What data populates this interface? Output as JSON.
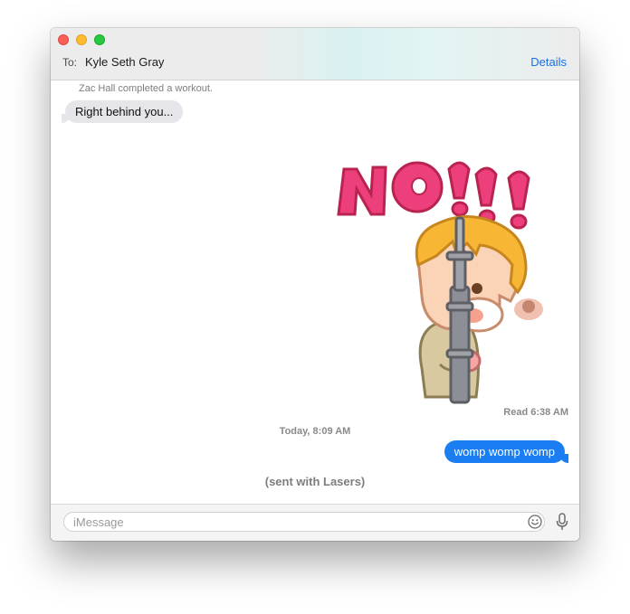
{
  "header": {
    "to_label": "To:",
    "recipient": "Kyle Seth Gray",
    "details_label": "Details"
  },
  "transcript": {
    "system_note": "Zac Hall completed a workout.",
    "incoming_message": "Right behind you...",
    "sticker": {
      "text": "NO!!!",
      "description_icon": "sticker-image"
    },
    "read_receipt": "Read 6:38 AM",
    "timestamp": "Today, 8:09 AM",
    "outgoing_message": "womp womp womp",
    "effect_note": "(sent with Lasers)"
  },
  "composer": {
    "placeholder": "iMessage",
    "value": ""
  },
  "icons": {
    "emoji": "emoji-icon",
    "mic": "microphone-icon"
  },
  "colors": {
    "accent_blue": "#1a7ef2",
    "incoming_bubble": "#e5e5ea",
    "details_link": "#1b6fe3",
    "sticker_pink": "#ee3f7d"
  }
}
